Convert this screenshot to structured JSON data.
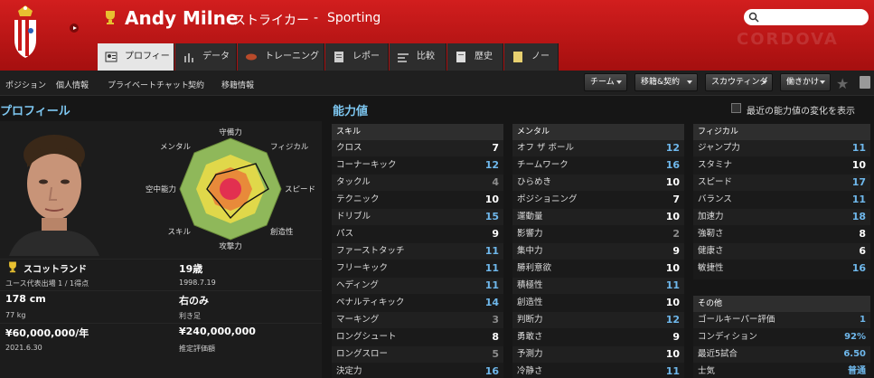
{
  "player": {
    "name": "Andy Milne",
    "role": "ストライカー",
    "separator": "-",
    "club": "Sporting"
  },
  "watermark": "CORDOVA",
  "tabs": [
    {
      "label": "プロフィール",
      "icon": "profile-icon",
      "active": true
    },
    {
      "label": "データ",
      "icon": "bar-chart-icon"
    },
    {
      "label": "トレーニング",
      "icon": "training-ball-icon"
    },
    {
      "label": "レポート",
      "icon": "report-icon"
    },
    {
      "label": "比較",
      "icon": "compare-icon"
    },
    {
      "label": "歴史",
      "icon": "history-icon"
    },
    {
      "label": "ノート",
      "icon": "note-icon"
    }
  ],
  "subnav": [
    "ポジション",
    "個人情報",
    "プライベートチャット",
    "契約",
    "移籍情報"
  ],
  "dropdowns": [
    "チーム",
    "移籍&契約",
    "スカウティング",
    "働きかけ"
  ],
  "sections": {
    "profile": "プロフィール",
    "abilities": "能力値",
    "recent_change": "最近の能力値の変化を表示"
  },
  "radar": {
    "labels": [
      "守備力",
      "フィジカル",
      "スピード",
      "創造性",
      "攻撃力",
      "スキル",
      "空中能力",
      "メンタル"
    ]
  },
  "info": {
    "nationality": "スコットランド",
    "age": "19歳",
    "youth_caps": "ユース代表出場 1 / 1得点",
    "birthdate": "1998.7.19",
    "height": "178 cm",
    "foot": "右のみ",
    "weight": "77 kg",
    "foot_label": "利き足",
    "wage": "¥60,000,000/年",
    "value": "¥240,000,000",
    "contract_end": "2021.6.30",
    "value_label": "推定評価額"
  },
  "attributes": {
    "skill": {
      "title": "スキル",
      "rows": [
        [
          "クロス",
          "7"
        ],
        [
          "コーナーキック",
          "12"
        ],
        [
          "タックル",
          "4"
        ],
        [
          "テクニック",
          "10"
        ],
        [
          "ドリブル",
          "15"
        ],
        [
          "パス",
          "9"
        ],
        [
          "ファーストタッチ",
          "11"
        ],
        [
          "フリーキック",
          "11"
        ],
        [
          "ヘディング",
          "11"
        ],
        [
          "ペナルティキック",
          "14"
        ],
        [
          "マーキング",
          "3"
        ],
        [
          "ロングシュート",
          "8"
        ],
        [
          "ロングスロー",
          "5"
        ],
        [
          "決定力",
          "16"
        ]
      ]
    },
    "mental": {
      "title": "メンタル",
      "rows": [
        [
          "オフ ザ ボール",
          "12"
        ],
        [
          "チームワーク",
          "16"
        ],
        [
          "ひらめき",
          "10"
        ],
        [
          "ポジショニング",
          "7"
        ],
        [
          "運動量",
          "10"
        ],
        [
          "影響力",
          "2"
        ],
        [
          "集中力",
          "9"
        ],
        [
          "勝利意欲",
          "10"
        ],
        [
          "積極性",
          "11"
        ],
        [
          "創造性",
          "10"
        ],
        [
          "判断力",
          "12"
        ],
        [
          "勇敢さ",
          "9"
        ],
        [
          "予測力",
          "10"
        ],
        [
          "冷静さ",
          "11"
        ]
      ]
    },
    "physical": {
      "title": "フィジカル",
      "rows": [
        [
          "ジャンプ力",
          "11"
        ],
        [
          "スタミナ",
          "10"
        ],
        [
          "スピード",
          "17"
        ],
        [
          "バランス",
          "11"
        ],
        [
          "加速力",
          "18"
        ],
        [
          "強靭さ",
          "8"
        ],
        [
          "健康さ",
          "6"
        ],
        [
          "敏捷性",
          "16"
        ]
      ]
    },
    "other": {
      "title": "その他",
      "rows": [
        [
          "ゴールキーパー評価",
          "1"
        ],
        [
          "コンディション",
          "92%"
        ],
        [
          "最近5試合",
          "6.50"
        ],
        [
          "士気",
          "普通"
        ]
      ]
    }
  },
  "colors": {
    "header": "#c41818",
    "accent_text": "#7ec8f2",
    "high": "#6fb8ec",
    "mid": "#ffffff",
    "low": "#8c8c8c",
    "radar_outer": "#7fb24a",
    "radar_mid": "#e0d84a",
    "radar_inner": "#e46a3a",
    "radar_core": "#e23050"
  }
}
